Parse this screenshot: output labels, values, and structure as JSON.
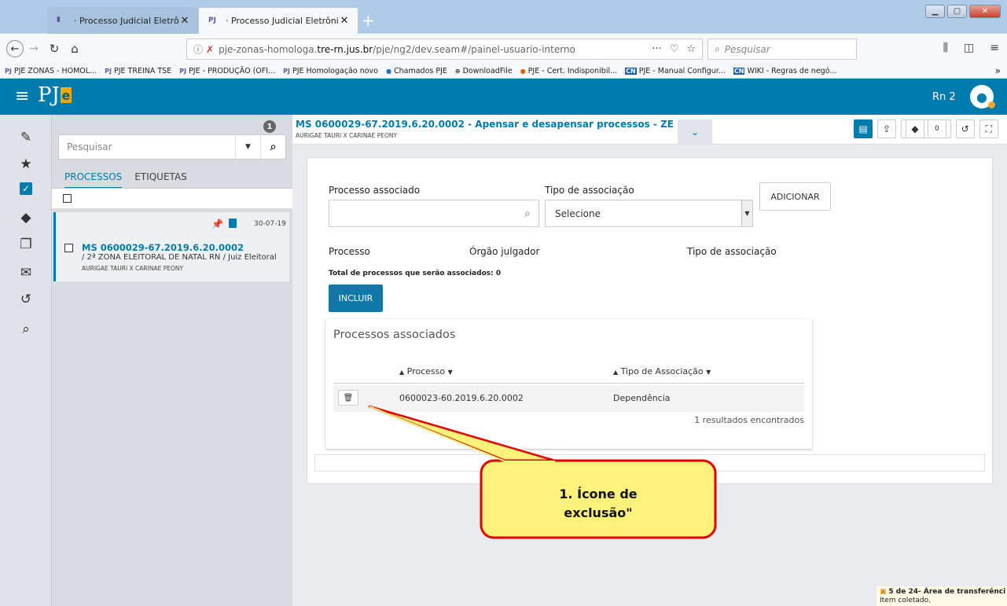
{
  "browser": {
    "tabs": [
      {
        "label": "· Processo Judicial Eletrônico -"
      },
      {
        "label": "· Processo Judicial Eletrônico -"
      }
    ],
    "url_prefix": "pje-zonas-homologa.",
    "url_domain": "tre-rn.jus.br",
    "url_path": "/pje/ng2/dev.seam#/painel-usuario-interno",
    "search_placeholder": "Pesquisar",
    "bookmarks": [
      "PJE ZONAS - HOMOL...",
      "PJE TREINA TSE",
      "PJE - PRODUÇÃO (OFI...",
      "PJE Homologação novo",
      "Chamados PJE",
      "DownloadFile",
      "PJE - Cert. Indisponibil...",
      "PJE - Manual Configur...",
      "WIKI - Regras de negó..."
    ]
  },
  "header": {
    "logo": "PJ",
    "logo_e": "e",
    "user": "Rn 2"
  },
  "list": {
    "badge": "1",
    "search_placeholder": "Pesquisar",
    "tabs": [
      "PROCESSOS",
      "ETIQUETAS"
    ],
    "card": {
      "date": "30-07-19",
      "number": "MS 0600029-67.2019.6.20.0002",
      "orgao": "/ 2ª ZONA ELEITORAL DE NATAL RN / Juiz Eleitoral",
      "parts": "AURIGAE TAURI X CARINAE PEONY"
    }
  },
  "detail": {
    "title": "MS 0600029-67.2019.6.20.0002 - Apensar e desapensar processos - ZE",
    "parts": "AURIGAE TAURI X CARINAE PEONY",
    "tools": {
      "tags_count": "0"
    }
  },
  "form": {
    "processo_label": "Processo associado",
    "tipo_label": "Tipo de associação",
    "tipo_value": "Selecione",
    "add_button": "ADICIONAR",
    "col_processo": "Processo",
    "col_orgao": "Órgão julgador",
    "col_tipo": "Tipo de associação",
    "total": "Total de processos que serão associados: 0",
    "incluir_button": "INCLUIR"
  },
  "associados": {
    "title": "Processos associados",
    "headers": [
      "Processo",
      "Tipo de Associação"
    ],
    "rows": [
      {
        "processo": "0600023-60.2019.6.20.0002",
        "tipo": "Dependência"
      }
    ],
    "results": "1 resultados encontrados"
  },
  "callout": {
    "line1": "1. Ícone de",
    "line2": "exclusão\""
  },
  "notification": {
    "title": "5 de 24- Área de transferênci",
    "subtitle": "Item coletado."
  },
  "colors": {
    "brand": "#007bad",
    "callout_fill": "#fef27a",
    "callout_border": "#e60000"
  }
}
